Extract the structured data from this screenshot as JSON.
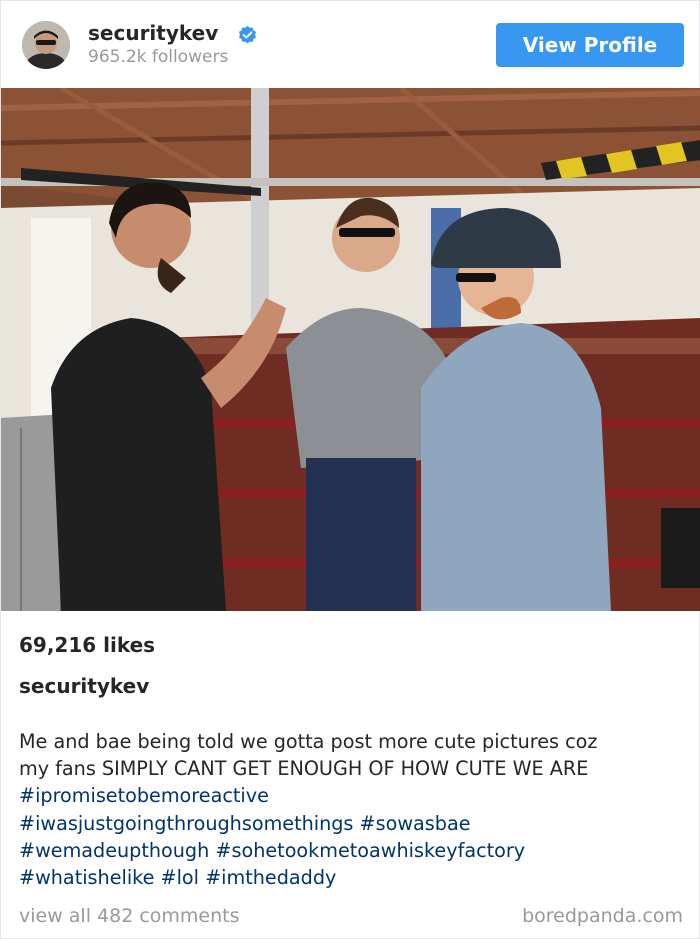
{
  "header": {
    "username": "securitykev",
    "followers": "965.2k followers",
    "view_profile_label": "View Profile",
    "verified_icon": "verified-badge-icon",
    "accent": "#3897f0"
  },
  "post": {
    "image_description_icon": "photo",
    "likes": "69,216 likes",
    "caption_user": "securitykev",
    "caption_lines": [
      "Me and bae being told we gotta post more cute pictures coz",
      "my fans SIMPLY CANT GET ENOUGH OF HOW CUTE WE ARE"
    ],
    "hashtags": [
      "#ipromisetobemoreactive",
      "#iwasjustgoingthroughsomethings",
      "#sowasbae",
      "#wemadeupthough",
      "#sohetookmetoawhiskeyfactory",
      "#whatishelike",
      "#lol",
      "#imthedaddy"
    ],
    "comments_link": "view all 482 comments",
    "source": "boredpanda.com",
    "hashtag_color": "#003569"
  }
}
